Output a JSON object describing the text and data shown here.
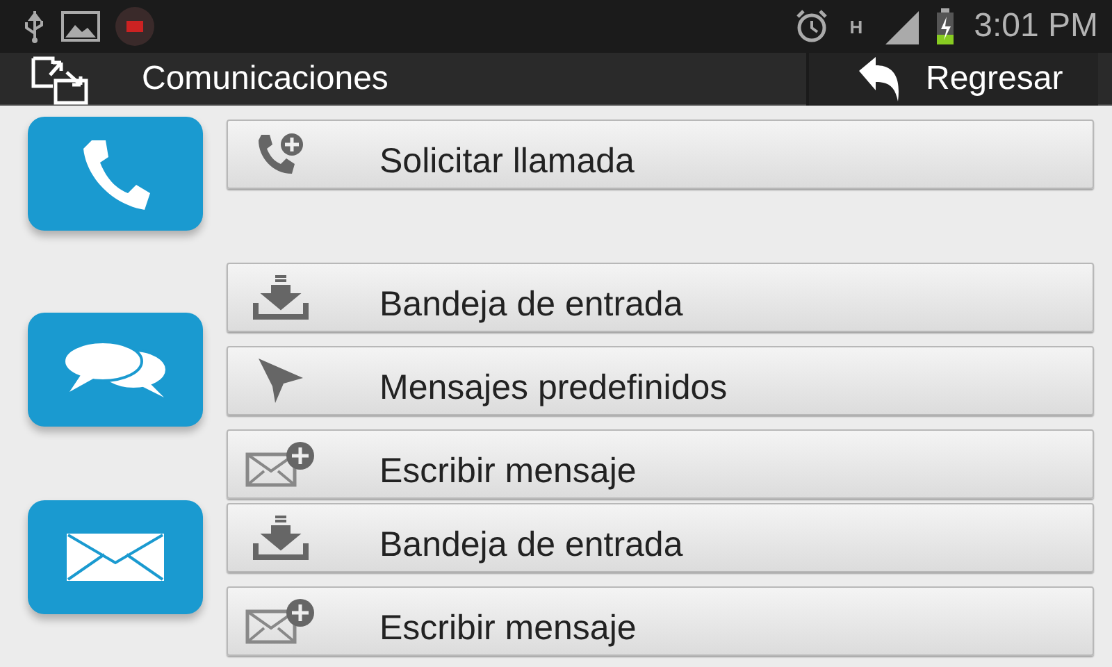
{
  "status_bar": {
    "network": "H",
    "time": "3:01 PM"
  },
  "action_bar": {
    "title": "Comunicaciones",
    "back_label": "Regresar"
  },
  "groups": [
    {
      "kind": "phone",
      "buttons": [
        {
          "kind": "call",
          "label": "Solicitar llamada"
        }
      ]
    },
    {
      "kind": "chat",
      "buttons": [
        {
          "kind": "inbox",
          "label": "Bandeja de entrada"
        },
        {
          "kind": "preset",
          "label": "Mensajes predefinidos"
        },
        {
          "kind": "compose",
          "label": "Escribir mensaje"
        }
      ]
    },
    {
      "kind": "mail",
      "buttons": [
        {
          "kind": "inbox",
          "label": "Bandeja de entrada"
        },
        {
          "kind": "compose",
          "label": "Escribir mensaje"
        }
      ]
    }
  ]
}
